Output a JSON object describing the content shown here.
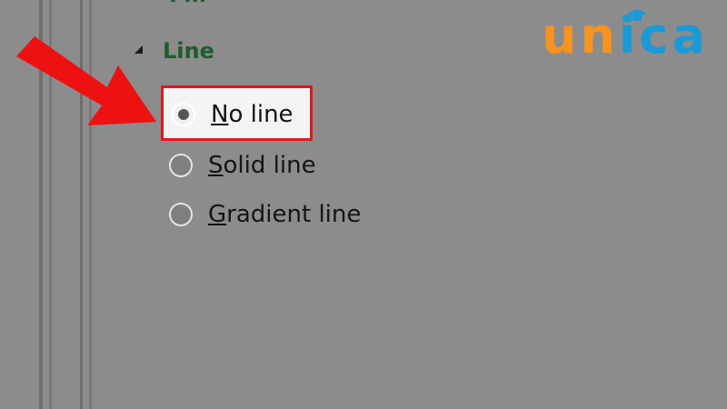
{
  "panel": {
    "previous_section_title": "Fill",
    "section": {
      "title": "Line",
      "collapse_icon": "triangle-down-icon",
      "options": [
        {
          "label_first": "N",
          "label_rest": "o line",
          "selected": true
        },
        {
          "label_first": "S",
          "label_rest": "olid line",
          "selected": false
        },
        {
          "label_first": "G",
          "label_rest": "radient line",
          "selected": false
        }
      ]
    }
  },
  "annotation": {
    "arrow_icon": "red-arrow-icon",
    "highlight_color": "#e01a1a"
  },
  "logo": {
    "u": "u",
    "n": "n",
    "i": "i",
    "c": "c",
    "a": "a",
    "orange": "#f7931e",
    "blue": "#1a9ad6"
  }
}
